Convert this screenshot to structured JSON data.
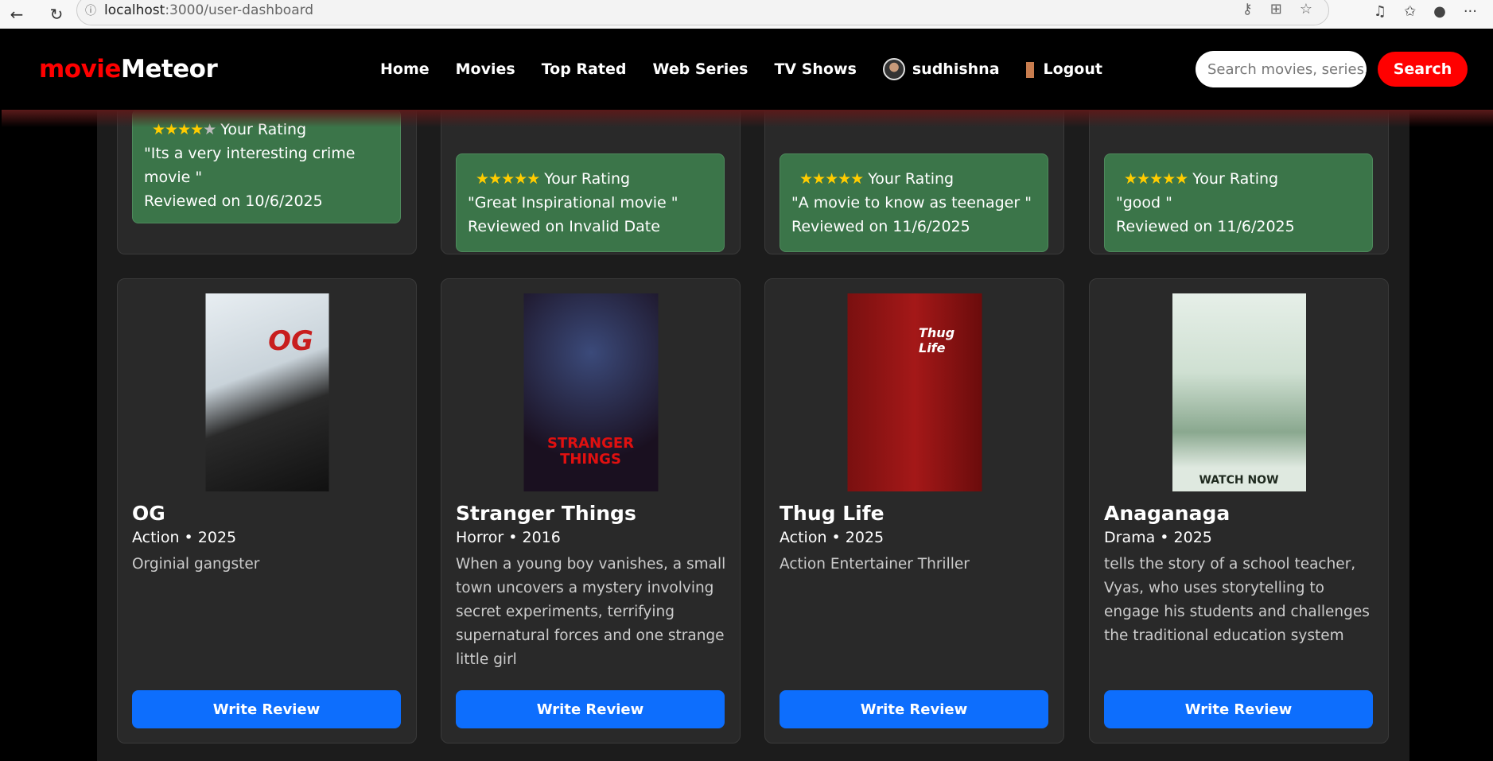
{
  "browser": {
    "url_host": "localhost",
    "url_path": ":3000/user-dashboard"
  },
  "nav": {
    "logo_a": "movie",
    "logo_b": "Meteor",
    "links": [
      "Home",
      "Movies",
      "Top Rated",
      "Web Series",
      "TV Shows"
    ],
    "user": "sudhishna",
    "logout": "Logout",
    "search_placeholder": "Search movies, series...",
    "search_label": "Search"
  },
  "reviews": [
    {
      "stars_on": "★★★★",
      "stars_off": "★",
      "rating": 4,
      "label": "Your Rating",
      "text": "\"Its a very interesting crime movie \"",
      "date": "Reviewed on 10/6/2025"
    },
    {
      "stars_on": "★★★★★",
      "stars_off": "",
      "rating": 5,
      "label": "Your Rating",
      "text": "\"Great Inspirational movie \"",
      "date": "Reviewed on Invalid Date"
    },
    {
      "stars_on": "★★★★★",
      "stars_off": "",
      "rating": 5,
      "label": "Your Rating",
      "text": "\"A movie to know as teenager \"",
      "date": "Reviewed on 11/6/2025"
    },
    {
      "stars_on": "★★★★★",
      "stars_off": "",
      "rating": 5,
      "label": "Your Rating",
      "text": "\"good \"",
      "date": "Reviewed on 11/6/2025"
    }
  ],
  "movies": [
    {
      "title": "OG",
      "meta": "Action • 2025",
      "desc": "Orginial gangster",
      "poster_text": "OG",
      "button": "Write Review"
    },
    {
      "title": "Stranger Things",
      "meta": "Horror • 2016",
      "desc": "When a young boy vanishes, a small town uncovers a mystery involving secret experiments, terrifying supernatural forces and one strange little girl",
      "poster_text": "STRANGER THINGS",
      "button": "Write Review"
    },
    {
      "title": "Thug Life",
      "meta": "Action • 2025",
      "desc": "Action Entertainer Thriller",
      "poster_text": "Thug Life",
      "button": "Write Review"
    },
    {
      "title": "Anaganaga",
      "meta": "Drama • 2025",
      "desc": "tells the story of a school teacher, Vyas, who uses storytelling to engage his students and challenges the traditional education system",
      "poster_text": "WATCH NOW",
      "button": "Write Review"
    }
  ]
}
